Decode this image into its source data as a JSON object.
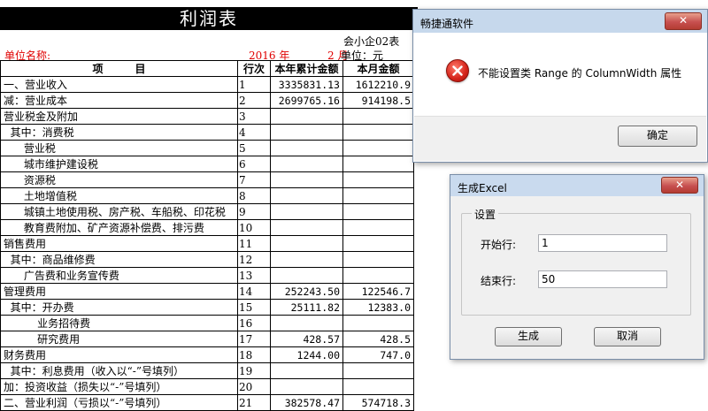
{
  "sheet": {
    "title": "利润表",
    "form_code": "会小企02表",
    "unit_name_label": "单位名称:",
    "year": "2016 年",
    "month": "2 月",
    "unit": "单位：元",
    "columns": [
      "项　　　目",
      "行次",
      "本年累计金额",
      "本月金额"
    ],
    "rows": [
      {
        "item": "一、营业收入",
        "line": "1",
        "ytd": "3335831.13",
        "month": "1612210.9"
      },
      {
        "item": "减：营业成本",
        "line": "2",
        "ytd": "2699765.16",
        "month": "914198.5"
      },
      {
        "item": "营业税金及附加",
        "line": "3",
        "ytd": "",
        "month": ""
      },
      {
        "item": "  其中：消费税",
        "line": "4",
        "ytd": "",
        "month": ""
      },
      {
        "item": "      营业税",
        "line": "5",
        "ytd": "",
        "month": ""
      },
      {
        "item": "      城市维护建设税",
        "line": "6",
        "ytd": "",
        "month": ""
      },
      {
        "item": "      资源税",
        "line": "7",
        "ytd": "",
        "month": ""
      },
      {
        "item": "      土地增值税",
        "line": "8",
        "ytd": "",
        "month": ""
      },
      {
        "item": "      城镇土地使用税、房产税、车船税、印花税",
        "line": "9",
        "ytd": "",
        "month": ""
      },
      {
        "item": "      教育费附加、矿产资源补偿费、排污费",
        "line": "10",
        "ytd": "",
        "month": ""
      },
      {
        "item": "销售费用",
        "line": "11",
        "ytd": "",
        "month": ""
      },
      {
        "item": "  其中：商品维修费",
        "line": "12",
        "ytd": "",
        "month": ""
      },
      {
        "item": "      广告费和业务宣传费",
        "line": "13",
        "ytd": "",
        "month": ""
      },
      {
        "item": "管理费用",
        "line": "14",
        "ytd": "252243.50",
        "month": "122546.7"
      },
      {
        "item": "  其中：开办费",
        "line": "15",
        "ytd": "25111.82",
        "month": "12383.0"
      },
      {
        "item": "          业务招待费",
        "line": "16",
        "ytd": "",
        "month": ""
      },
      {
        "item": "          研究费用",
        "line": "17",
        "ytd": "428.57",
        "month": "428.5"
      },
      {
        "item": "财务费用",
        "line": "18",
        "ytd": "1244.00",
        "month": "747.0"
      },
      {
        "item": "  其中：利息费用（收入以“-”号填列）",
        "line": "19",
        "ytd": "",
        "month": ""
      },
      {
        "item": "加：投资收益（损失以“-”号填列）",
        "line": "20",
        "ytd": "",
        "month": ""
      },
      {
        "item": "二、营业利润（亏损以“-”号填列）",
        "line": "21",
        "ytd": "382578.47",
        "month": "574718.3"
      }
    ]
  },
  "message_dialog": {
    "title": "畅捷通软件",
    "close_label": "✕",
    "icon": "error-icon",
    "message": "不能设置类 Range 的 ColumnWidth 属性",
    "ok_label": "确定"
  },
  "excel_dialog": {
    "title": "生成Excel",
    "close_label": "✕",
    "group_label": "设置",
    "start_label": "开始行:",
    "start_value": "1",
    "end_label": "结束行:",
    "end_value": "50",
    "generate_label": "生成",
    "cancel_label": "取消"
  }
}
